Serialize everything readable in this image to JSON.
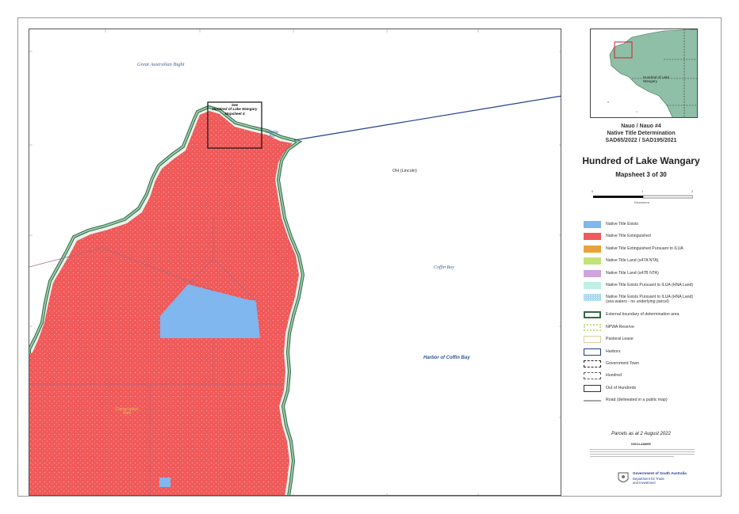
{
  "map": {
    "water_labels": {
      "bight": "Great Australian Bight",
      "sensible_bay": "Sensible Bay",
      "coffin_bay": "Coffin Bay",
      "harbor": "Harbor of Coffin Bay"
    },
    "see_box": {
      "line1": "See",
      "line2": "Hundred of Lake Wangary",
      "line3": "Mapsheet 4"
    },
    "oh_label": "OH (Lincoln)",
    "park_label": "Conservation Park",
    "colors": {
      "extinguished": "#f05a5a",
      "native_title_exists": "#7fb7ee",
      "ilua_extinguished": "#e8a33b",
      "s47a": "#c4e27a",
      "s47b": "#cfa5dc",
      "hna_land": "#bff0e6",
      "hna_sea": "#a9d8ec",
      "boundary": "#2f6b47",
      "npwa": "#c8de88",
      "pastoral": "#d8d0a2",
      "harbors": "#1f3f8a",
      "road": "#a6a6a6",
      "coast_green": "#5f9e74",
      "land_inset": "#8fbfa6"
    }
  },
  "inset": {
    "label": "Hundred of Lake Wangary"
  },
  "titles": {
    "line1": "Nauo / Nauo #4",
    "line2": "Native Title Determination",
    "line3": "SAD65/2022 / SAD195/2021",
    "main": "Hundred of Lake Wangary",
    "sheet": "Mapsheet 3 of 30"
  },
  "scale": {
    "t0": "0",
    "t1": "1",
    "t2": "2",
    "unit": "Kilometers"
  },
  "legend": [
    {
      "name": "legend-native-title-exists",
      "label": "Native Title Exists",
      "swatch": "exists"
    },
    {
      "name": "legend-native-title-extinguished",
      "label": "Native Title Extinguished",
      "swatch": "extinguished"
    },
    {
      "name": "legend-ilua-extinguished",
      "label": "Native Title Extinguished Pursuant to ILUA",
      "swatch": "ilua"
    },
    {
      "name": "legend-s47a",
      "label": "Native Title Land (s47A NTA)",
      "swatch": "s47a"
    },
    {
      "name": "legend-s47b",
      "label": "Native Title Land (s47B NTA)",
      "swatch": "s47b"
    },
    {
      "name": "legend-hna-land",
      "label": "Native Title Exists Pursuant to ILUA (HNA Land)",
      "swatch": "hna"
    },
    {
      "name": "legend-hna-sea",
      "label": "Native Title Exists Pursuant to ILUA (HNA Land)",
      "label2": "(sea waters - no underlying parcel)",
      "swatch": "hnasea"
    },
    {
      "name": "legend-external-boundary",
      "label": "External boundary of determination area",
      "swatch": "boundary"
    },
    {
      "name": "legend-npwa-reserve",
      "label": "NPWA Reserve",
      "swatch": "npwa"
    },
    {
      "name": "legend-pastoral-lease",
      "label": "Pastoral Lease",
      "swatch": "pastoral"
    },
    {
      "name": "legend-harbors",
      "label": "Harbors",
      "swatch": "harbors"
    },
    {
      "name": "legend-government-town",
      "label": "Government Town",
      "swatch": "town"
    },
    {
      "name": "legend-hundred",
      "label": "Hundred",
      "swatch": "hundred"
    },
    {
      "name": "legend-out-of-hundreds",
      "label": "Out of Hundreds",
      "swatch": "out"
    },
    {
      "name": "legend-road",
      "label": "Road (delineated in a public map)",
      "swatch": "road"
    }
  ],
  "footer": {
    "parcels": "Parcels as at 2 August 2022",
    "disclaimer_title": "DISCLAIMER",
    "gov_line1": "Government of South Australia",
    "gov_line2": "Department for Trade",
    "gov_line3": "and Investment"
  }
}
